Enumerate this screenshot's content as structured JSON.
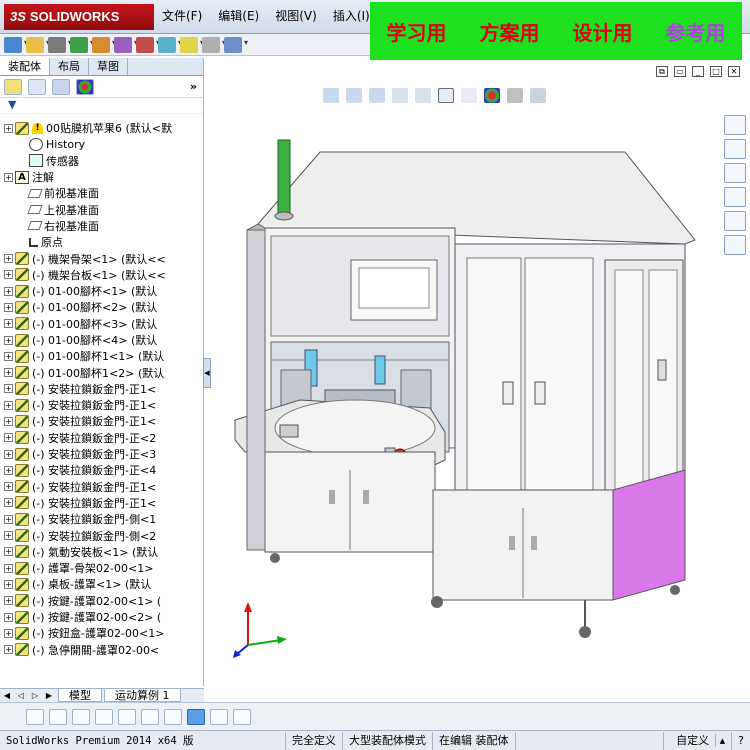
{
  "app": {
    "logo_text": "SOLIDWORKS",
    "logo_prefix": "3S",
    "menu": [
      "文件(F)",
      "编辑(E)",
      "视图(V)",
      "插入(I)"
    ]
  },
  "watermark": [
    "学习用",
    "方案用",
    "设计用",
    "参考用"
  ],
  "panel_tabs": [
    "装配体",
    "布局",
    "草图"
  ],
  "manager_more": "»",
  "filter_icon": "filter-icon",
  "tree": [
    {
      "indent": 0,
      "expand": "+",
      "icon": "assembly",
      "warn": true,
      "label": "00贴膜机苹果6  (默认<默"
    },
    {
      "indent": 1,
      "expand": "",
      "icon": "history",
      "label": "History"
    },
    {
      "indent": 1,
      "expand": "",
      "icon": "sensor",
      "label": "传感器"
    },
    {
      "indent": 0,
      "expand": "+",
      "icon": "note",
      "label": "注解"
    },
    {
      "indent": 1,
      "expand": "",
      "icon": "plane",
      "label": "前视基准面"
    },
    {
      "indent": 1,
      "expand": "",
      "icon": "plane",
      "label": "上视基准面"
    },
    {
      "indent": 1,
      "expand": "",
      "icon": "plane",
      "label": "右视基准面"
    },
    {
      "indent": 1,
      "expand": "",
      "icon": "origin",
      "label": "原点"
    },
    {
      "indent": 0,
      "expand": "+",
      "icon": "comp",
      "label": "(-) 機架骨架<1>  (默认<<"
    },
    {
      "indent": 0,
      "expand": "+",
      "icon": "comp",
      "label": "(-) 機架台板<1>  (默认<<"
    },
    {
      "indent": 0,
      "expand": "+",
      "icon": "comp",
      "label": "(-) 01-00腳杯<1>  (默认"
    },
    {
      "indent": 0,
      "expand": "+",
      "icon": "comp",
      "label": "(-) 01-00腳杯<2>  (默认"
    },
    {
      "indent": 0,
      "expand": "+",
      "icon": "comp",
      "label": "(-) 01-00腳杯<3>  (默认"
    },
    {
      "indent": 0,
      "expand": "+",
      "icon": "comp",
      "label": "(-) 01-00腳杯<4>  (默认"
    },
    {
      "indent": 0,
      "expand": "+",
      "icon": "comp",
      "label": "(-) 01-00腳杯1<1>  (默认"
    },
    {
      "indent": 0,
      "expand": "+",
      "icon": "comp",
      "label": "(-) 01-00腳杯1<2>  (默认"
    },
    {
      "indent": 0,
      "expand": "+",
      "icon": "comp",
      "label": "(-) 安裝拉鎖鈑金門-正1<"
    },
    {
      "indent": 0,
      "expand": "+",
      "icon": "comp",
      "label": "(-) 安裝拉鎖鈑金門-正1<"
    },
    {
      "indent": 0,
      "expand": "+",
      "icon": "comp",
      "label": "(-) 安裝拉鎖鈑金門-正1<"
    },
    {
      "indent": 0,
      "expand": "+",
      "icon": "comp",
      "label": "(-) 安裝拉鎖鈑金門-正<2"
    },
    {
      "indent": 0,
      "expand": "+",
      "icon": "comp",
      "label": "(-) 安裝拉鎖鈑金門-正<3"
    },
    {
      "indent": 0,
      "expand": "+",
      "icon": "comp",
      "label": "(-) 安裝拉鎖鈑金門-正<4"
    },
    {
      "indent": 0,
      "expand": "+",
      "icon": "comp",
      "label": "(-) 安裝拉鎖鈑金門-正1<"
    },
    {
      "indent": 0,
      "expand": "+",
      "icon": "comp",
      "label": "(-) 安裝拉鎖鈑金門-正1<"
    },
    {
      "indent": 0,
      "expand": "+",
      "icon": "comp",
      "label": "(-) 安裝拉鎖鈑金門-側<1"
    },
    {
      "indent": 0,
      "expand": "+",
      "icon": "comp",
      "label": "(-) 安裝拉鎖鈑金門-側<2"
    },
    {
      "indent": 0,
      "expand": "+",
      "icon": "comp",
      "label": "(-) 氣動安裝板<1>  (默认"
    },
    {
      "indent": 0,
      "expand": "+",
      "icon": "comp",
      "label": "(-) 護罩-骨架02-00<1>"
    },
    {
      "indent": 0,
      "expand": "+",
      "icon": "comp",
      "label": "(-) 桌板-護罩<1>  (默认"
    },
    {
      "indent": 0,
      "expand": "+",
      "icon": "comp",
      "label": "(-) 按鍵-護罩02-00<1>  ("
    },
    {
      "indent": 0,
      "expand": "+",
      "icon": "comp",
      "label": "(-) 按鍵-護罩02-00<2>  ("
    },
    {
      "indent": 0,
      "expand": "+",
      "icon": "comp",
      "label": "(-) 按鈕盒-護罩02-00<1>"
    },
    {
      "indent": 0,
      "expand": "+",
      "icon": "comp",
      "label": "(-) 急停開關-護罩02-00<"
    }
  ],
  "model_tabs": [
    "模型",
    "运动算例 1"
  ],
  "status": {
    "product": "SolidWorks Premium 2014 x64 版",
    "defined": "完全定义",
    "mode": "大型装配体模式",
    "editing": "在编辑 装配体",
    "custom": "自定义"
  },
  "colors": {
    "frame": "#c9cbd2",
    "panel_purple": "#d978e8",
    "tower": "#3cb043",
    "table": "#e8e8e8"
  }
}
